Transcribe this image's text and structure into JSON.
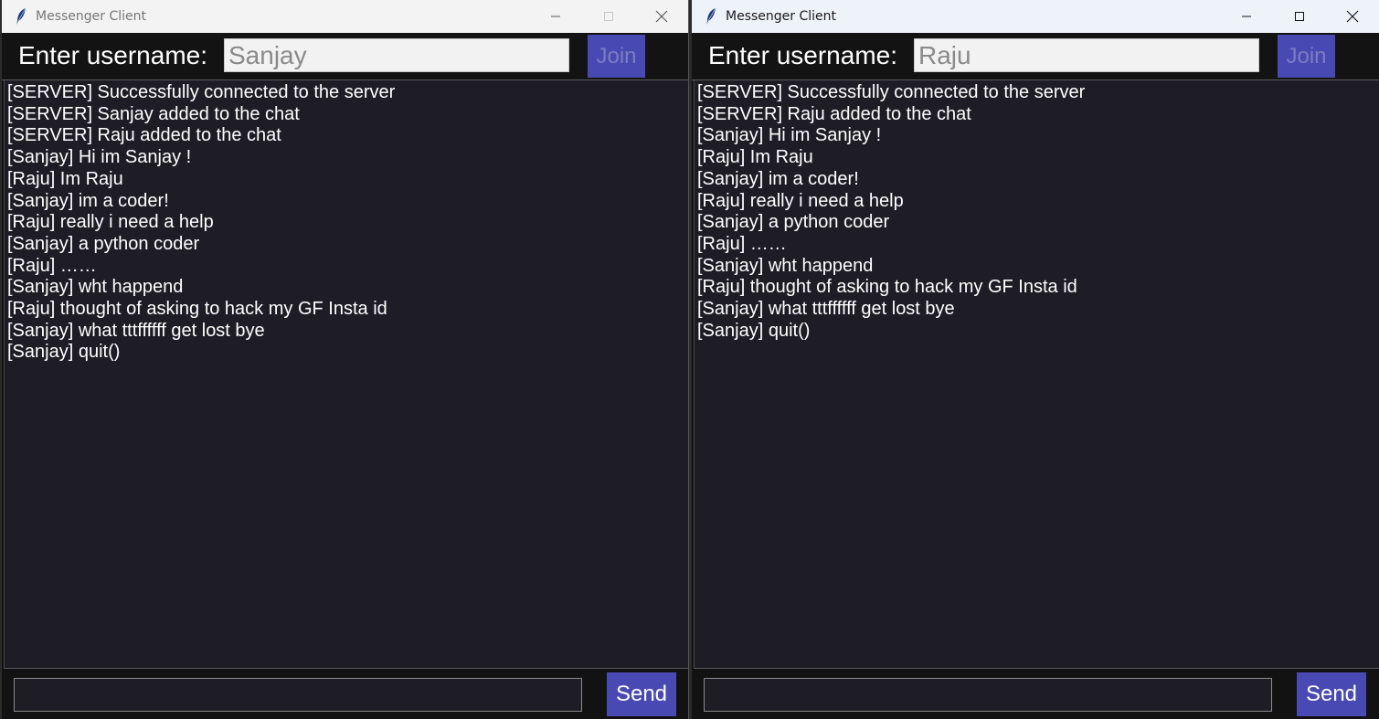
{
  "windows": [
    {
      "title": "Messenger Client",
      "username_label": "Enter username:",
      "username_value": "Sanjay",
      "join_label": "Join",
      "send_label": "Send",
      "message_input_value": "",
      "messages": [
        "[SERVER] Successfully connected to the server",
        "[SERVER] Sanjay added to the chat",
        "[SERVER] Raju added to the chat",
        "[Sanjay] Hi im Sanjay !",
        "[Raju] Im Raju",
        "[Sanjay] im a coder!",
        "[Raju] really i need a help",
        "[Sanjay] a python coder",
        "[Raju] ……",
        "[Sanjay] wht happend",
        "[Raju] thought of asking to hack my GF Insta id",
        "[Sanjay] what tttffffff get lost bye",
        "[Sanjay] quit()"
      ]
    },
    {
      "title": "Messenger Client",
      "username_label": "Enter username:",
      "username_value": "Raju",
      "join_label": "Join",
      "send_label": "Send",
      "message_input_value": "",
      "messages": [
        "[SERVER] Successfully connected to the server",
        "[SERVER] Raju added to the chat",
        "[Sanjay] Hi im Sanjay !",
        "[Raju] Im Raju",
        "[Sanjay] im a coder!",
        "[Raju] really i need a help",
        "[Sanjay] a python coder",
        "[Raju] ……",
        "[Sanjay] wht happend",
        "[Raju] thought of asking to hack my GF Insta id",
        "[Sanjay] what tttffffff get lost bye",
        "[Sanjay] quit()"
      ]
    }
  ],
  "icons": {
    "app": "feather-icon",
    "minimize": "minimize-icon",
    "maximize": "maximize-icon",
    "close": "close-icon"
  },
  "colors": {
    "chat_background": "#1e1c25",
    "button_accent": "#4949b3",
    "window_background": "#121212"
  }
}
